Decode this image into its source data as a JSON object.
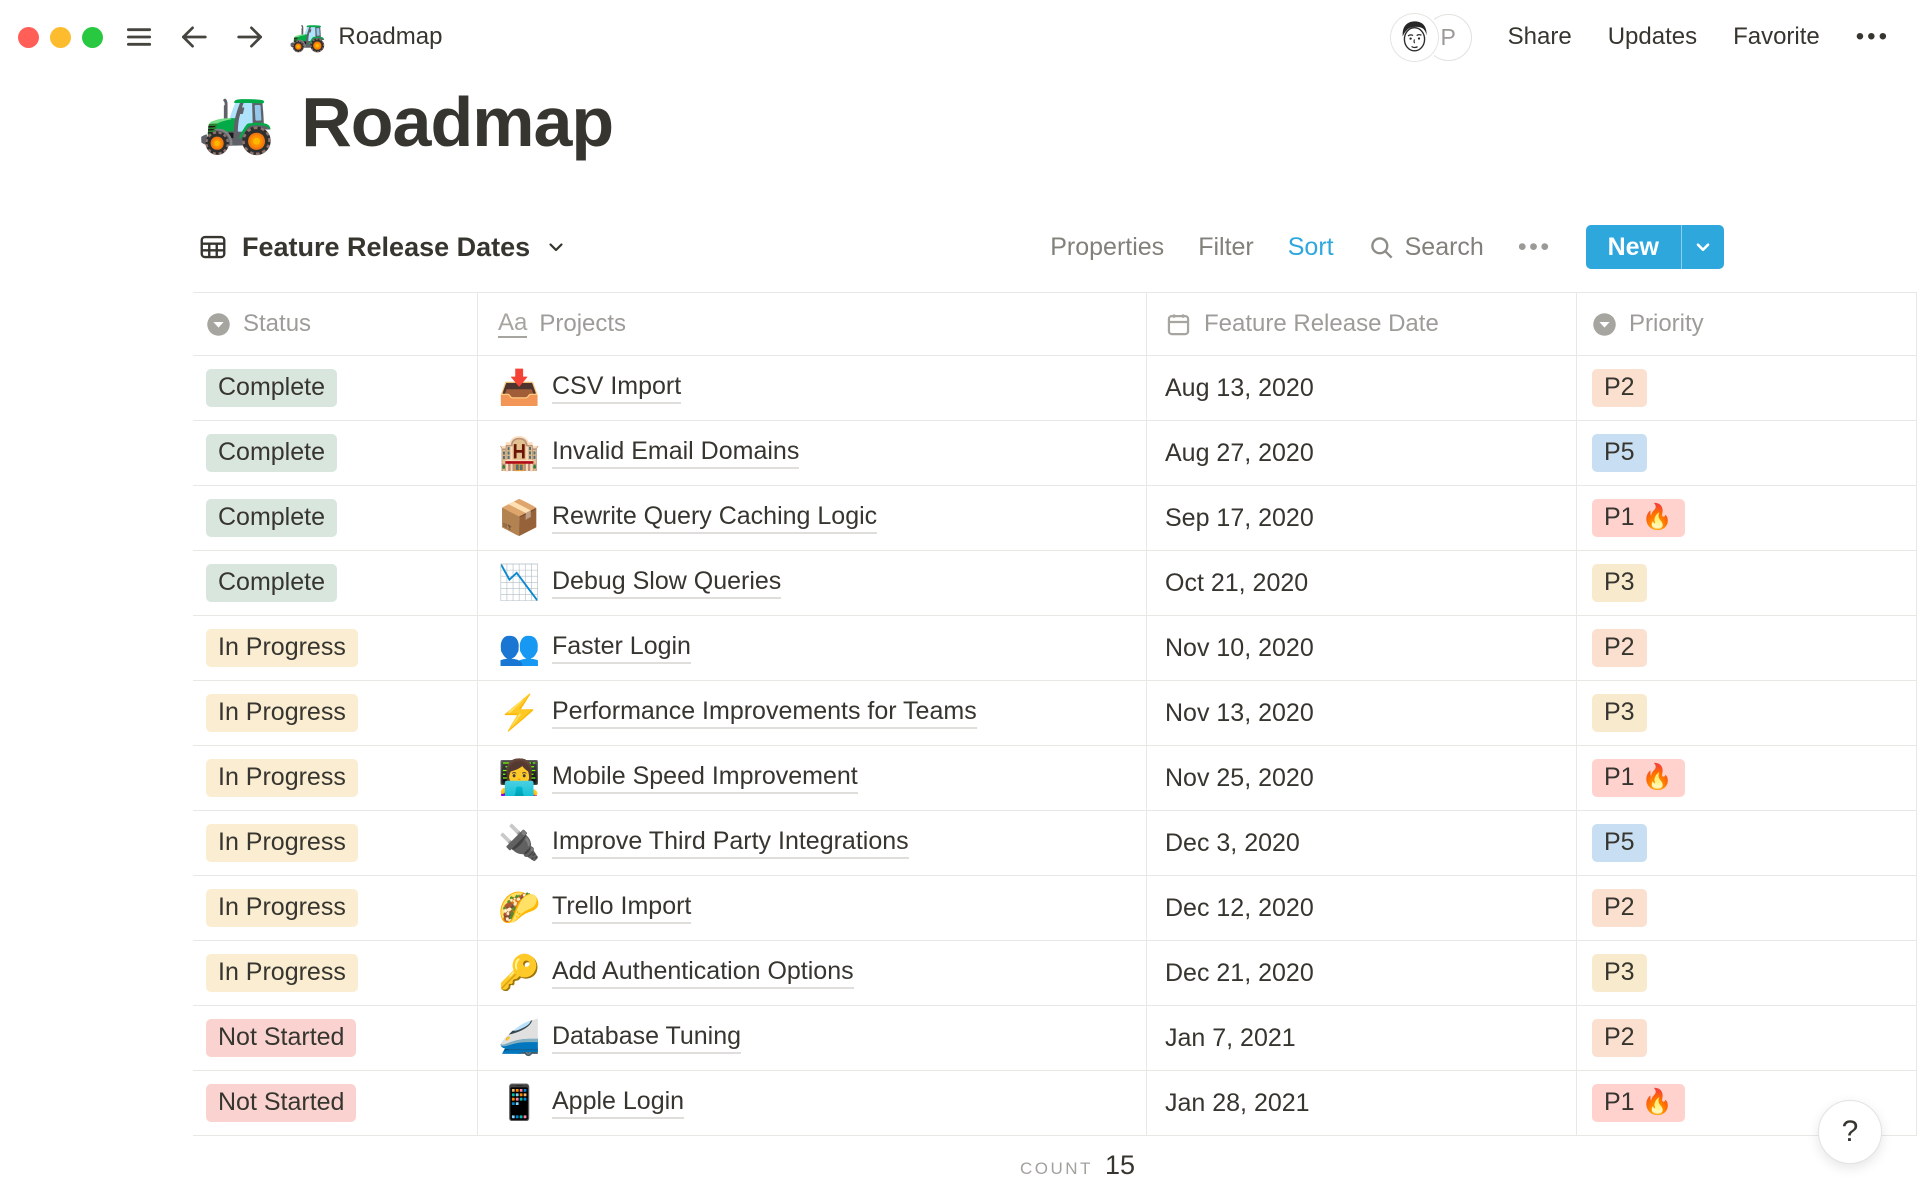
{
  "topbar": {
    "breadcrumb": {
      "icon": "🚜",
      "label": "Roadmap"
    },
    "avatar_initial": "P",
    "actions": [
      "Share",
      "Updates",
      "Favorite"
    ],
    "more": "•••"
  },
  "page": {
    "icon": "🚜",
    "title": "Roadmap"
  },
  "view_toolbar": {
    "view_name": "Feature Release Dates",
    "properties": "Properties",
    "filter": "Filter",
    "sort": "Sort",
    "search": "Search",
    "more": "•••",
    "new_label": "New"
  },
  "table": {
    "columns": [
      {
        "label": "Status",
        "type": "select"
      },
      {
        "label": "Projects",
        "type": "title"
      },
      {
        "label": "Feature Release Date",
        "type": "date"
      },
      {
        "label": "Priority",
        "type": "select"
      }
    ],
    "rows": [
      {
        "status": "Complete",
        "icon": "📥",
        "project": "CSV Import",
        "date": "Aug 13, 2020",
        "priority": "P2"
      },
      {
        "status": "Complete",
        "icon": "🏨",
        "project": "Invalid Email Domains",
        "date": "Aug 27, 2020",
        "priority": "P5"
      },
      {
        "status": "Complete",
        "icon": "📦",
        "project": "Rewrite Query Caching Logic",
        "date": "Sep 17, 2020",
        "priority": "P1 🔥"
      },
      {
        "status": "Complete",
        "icon": "📉",
        "project": "Debug Slow Queries",
        "date": "Oct 21, 2020",
        "priority": "P3"
      },
      {
        "status": "In Progress",
        "icon": "👥",
        "project": "Faster Login",
        "date": "Nov 10, 2020",
        "priority": "P2"
      },
      {
        "status": "In Progress",
        "icon": "⚡",
        "project": "Performance Improvements for Teams",
        "date": "Nov 13, 2020",
        "priority": "P3"
      },
      {
        "status": "In Progress",
        "icon": "👩‍💻",
        "project": "Mobile Speed Improvement",
        "date": "Nov 25, 2020",
        "priority": "P1 🔥"
      },
      {
        "status": "In Progress",
        "icon": "🔌",
        "project": "Improve Third Party Integrations",
        "date": "Dec 3, 2020",
        "priority": "P5"
      },
      {
        "status": "In Progress",
        "icon": "🌮",
        "project": "Trello Import",
        "date": "Dec 12, 2020",
        "priority": "P2"
      },
      {
        "status": "In Progress",
        "icon": "🔑",
        "project": "Add Authentication Options",
        "date": "Dec 21, 2020",
        "priority": "P3"
      },
      {
        "status": "Not Started",
        "icon": "🚄",
        "project": "Database Tuning",
        "date": "Jan 7, 2021",
        "priority": "P2"
      },
      {
        "status": "Not Started",
        "icon": "📱",
        "project": "Apple Login",
        "date": "Jan 28, 2021",
        "priority": "P1 🔥"
      }
    ],
    "badge_colors": {
      "Complete": "#D9E6DD",
      "In Progress": "#FAEDD2",
      "Not Started": "#FAD3D1",
      "P1 🔥": "#FFD2CE",
      "P2": "#FBDFCF",
      "P3": "#F8EACD",
      "P5": "#C8DEF2"
    }
  },
  "footer": {
    "count_label": "COUNT",
    "count_value": "15",
    "help": "?"
  },
  "colors": {
    "accent": "#2EA7DC",
    "traffic_red": "#FF5F57",
    "traffic_yellow": "#FDBC2E",
    "traffic_green": "#28C840"
  }
}
